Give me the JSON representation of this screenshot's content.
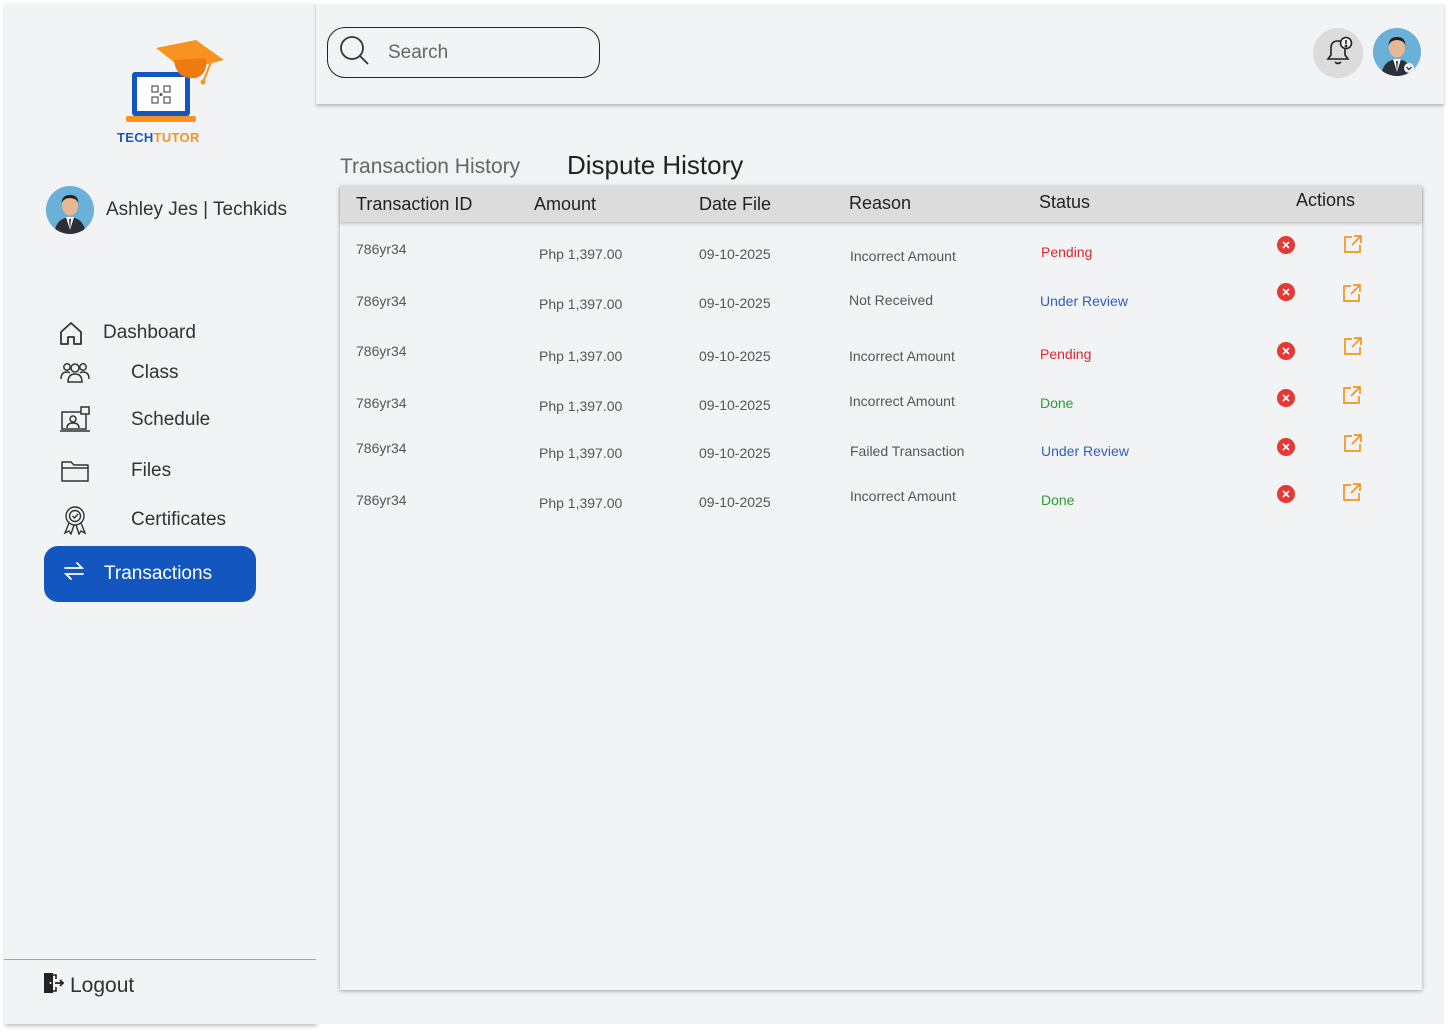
{
  "brand": {
    "name_part1": "TECH",
    "name_part2": "TUTOR",
    "colors": {
      "blue": "#1356c0",
      "orange": "#f7931e"
    }
  },
  "sidebar": {
    "profile_name": "Ashley Jes | Techkids",
    "items": [
      {
        "label": "Dashboard",
        "icon": "home-icon"
      },
      {
        "label": "Class",
        "icon": "users-icon"
      },
      {
        "label": "Schedule",
        "icon": "schedule-icon"
      },
      {
        "label": "Files",
        "icon": "folder-icon"
      },
      {
        "label": "Certificates",
        "icon": "certificate-icon"
      },
      {
        "label": "Transactions",
        "icon": "transfer-icon",
        "active": true
      }
    ],
    "logout_label": "Logout"
  },
  "topbar": {
    "search_placeholder": "Search"
  },
  "tabs": {
    "transaction_history": "Transaction History",
    "dispute_history": "Dispute History"
  },
  "table": {
    "headers": [
      "Transaction ID",
      "Amount",
      "Date File",
      "Reason",
      "Status",
      "Actions"
    ],
    "rows": [
      {
        "id": "786yr34",
        "amount": "Php 1,397.00",
        "date": "09-10-2025",
        "reason": "Incorrect  Amount",
        "status": "Pending"
      },
      {
        "id": "786yr34",
        "amount": "Php 1,397.00",
        "date": "09-10-2025",
        "reason": "Not Received",
        "status": "Under Review"
      },
      {
        "id": "786yr34",
        "amount": "Php 1,397.00",
        "date": "09-10-2025",
        "reason": "Incorrect  Amount",
        "status": "Pending"
      },
      {
        "id": "786yr34",
        "amount": "Php 1,397.00",
        "date": "09-10-2025",
        "reason": "Incorrect  Amount",
        "status": "Done"
      },
      {
        "id": "786yr34",
        "amount": "Php 1,397.00",
        "date": "09-10-2025",
        "reason": "Failed Transaction",
        "status": "Under Review"
      },
      {
        "id": "786yr34",
        "amount": "Php 1,397.00",
        "date": "09-10-2025",
        "reason": "Incorrect  Amount",
        "status": "Done"
      }
    ]
  }
}
